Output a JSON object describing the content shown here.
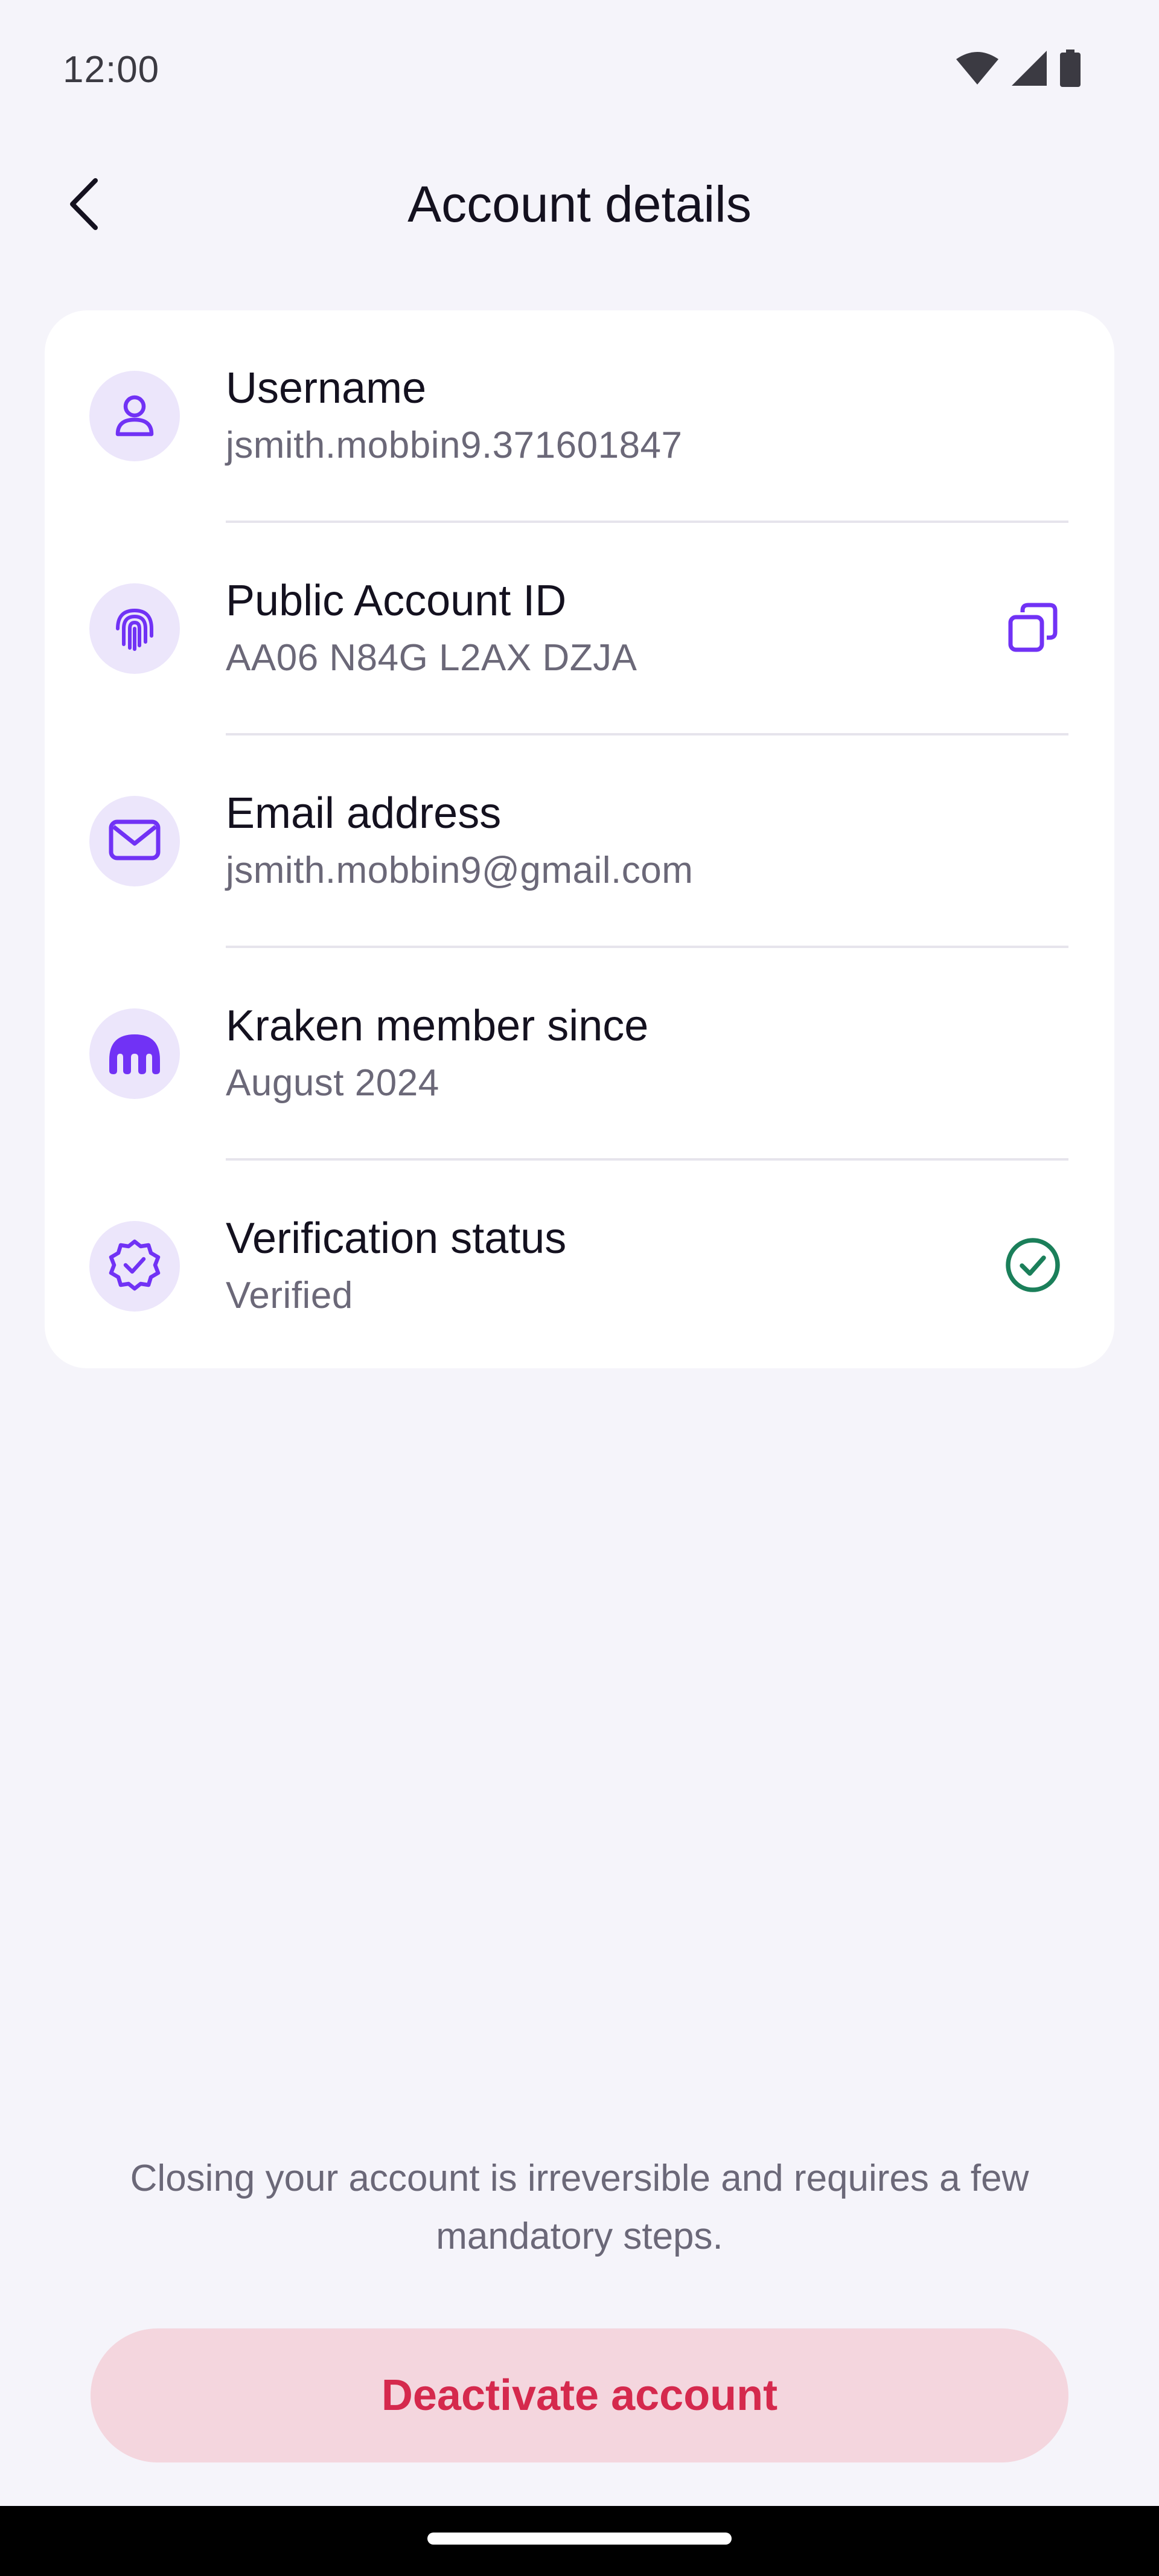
{
  "status_bar": {
    "time": "12:00",
    "icons": [
      "wifi-icon",
      "cellular-signal-icon",
      "battery-icon"
    ]
  },
  "header": {
    "title": "Account details",
    "back_icon": "chevron-left-icon"
  },
  "details": {
    "rows": [
      {
        "label": "Username",
        "value": "jsmith.mobbin9.371601847",
        "icon": "user-icon"
      },
      {
        "label": "Public Account ID",
        "value": "AA06 N84G L2AX DZJA",
        "icon": "fingerprint-icon",
        "action_icon": "copy-icon"
      },
      {
        "label": "Email address",
        "value": "jsmith.mobbin9@gmail.com",
        "icon": "mail-icon"
      },
      {
        "label": "Kraken member since",
        "value": "August 2024",
        "icon": "kraken-logo-icon"
      },
      {
        "label": "Verification status",
        "value": "Verified",
        "icon": "verified-badge-icon",
        "action_icon": "check-circle-icon"
      }
    ]
  },
  "footer": {
    "note": "Closing your account is irreversible and requires a few mandatory steps.",
    "deactivate_label": "Deactivate account"
  },
  "colors": {
    "background": "#f5f4fa",
    "accent": "#7132f5",
    "icon_bg": "#ece6fb",
    "verified": "#1b7f5a",
    "danger_text": "#d5294d",
    "danger_bg": "#f4d6de"
  }
}
